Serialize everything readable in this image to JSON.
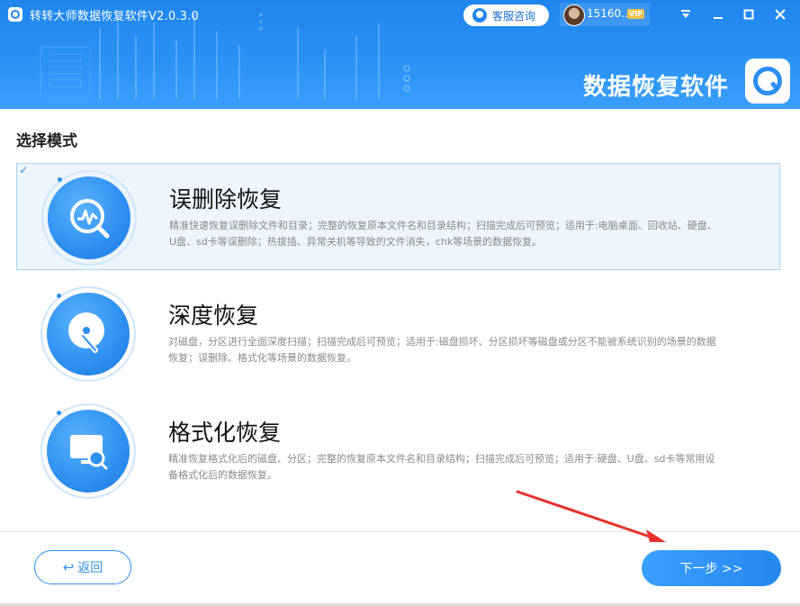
{
  "window": {
    "title": "转转大师数据恢复软件V2.0.3.0",
    "service_label": "客服咨询",
    "user_name": "15160...",
    "vip_badge": "VIP",
    "buttons": [
      "dropdown-icon",
      "minimize-icon",
      "maximize-icon",
      "close-icon"
    ]
  },
  "banner": {
    "brand_text": "数据恢复软件"
  },
  "main": {
    "section_title": "选择模式",
    "modes": [
      {
        "name": "误删除恢复",
        "description": "精准快速恢复误删除文件和目录；完整的恢复原本文件名和目录结构；扫描完成后可预览；适用于:电脑桌面、回收站、硬盘、U盘、sd卡等误删除；热拔插、异常关机等导致的文件消失，chk等场景的数据恢复。",
        "selected": true,
        "icon": "search-wave-icon"
      },
      {
        "name": "深度恢复",
        "description": "对磁盘，分区进行全面深度扫描；扫描完成后可预览；适用于:磁盘损坏、分区损坏等磁盘或分区不能被系统识别的场景的数据恢复；误删除、格式化等场景的数据恢复。",
        "selected": false,
        "icon": "disk-scan-icon"
      },
      {
        "name": "格式化恢复",
        "description": "精准恢复格式化后的磁盘、分区；完整的恢复原本文件名和目录结构；扫描完成后可预览；适用于:硬盘、U盘、sd卡等常用设备格式化后的数据恢复。",
        "selected": false,
        "icon": "monitor-search-icon"
      }
    ]
  },
  "footer": {
    "back_label": "返回",
    "next_label": "下一步 >>"
  },
  "colors": {
    "accent": "#2d8ff0",
    "banner": "#2b93f5",
    "annotation_arrow": "#e8322d"
  }
}
